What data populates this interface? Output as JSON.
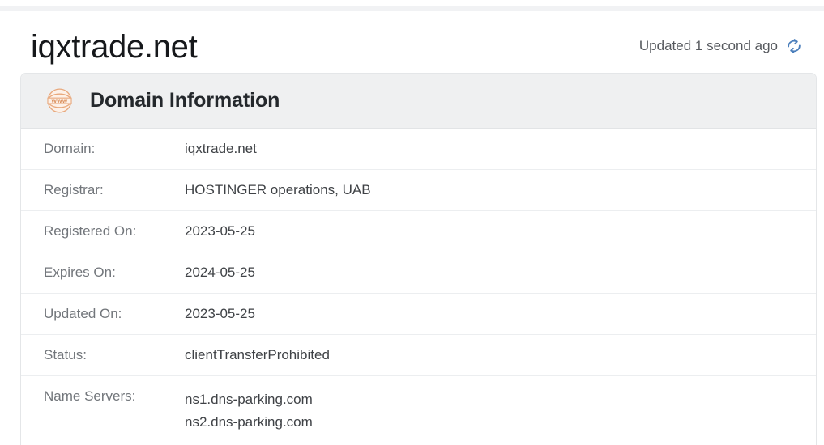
{
  "header": {
    "title": "iqxtrade.net",
    "updated_text": "Updated 1 second ago",
    "refresh_icon": "refresh-icon"
  },
  "card": {
    "icon": "www-globe-icon",
    "title": "Domain Information",
    "rows": [
      {
        "label": "Domain:",
        "value": "iqxtrade.net"
      },
      {
        "label": "Registrar:",
        "value": "HOSTINGER operations, UAB"
      },
      {
        "label": "Registered On:",
        "value": "2023-05-25"
      },
      {
        "label": "Expires On:",
        "value": "2024-05-25"
      },
      {
        "label": "Updated On:",
        "value": "2023-05-25"
      },
      {
        "label": "Status:",
        "value": "clientTransferProhibited"
      },
      {
        "label": "Name Servers:",
        "value": "ns1.dns-parking.com\nns2.dns-parking.com"
      }
    ]
  },
  "colors": {
    "accent_orange": "#e8a87c",
    "refresh_blue": "#4a7ebb",
    "card_header_bg": "#eff0f1",
    "card_border": "#e4e6e8",
    "label_text": "#72767b",
    "value_text": "#3f4246",
    "title_text": "#16181b"
  }
}
